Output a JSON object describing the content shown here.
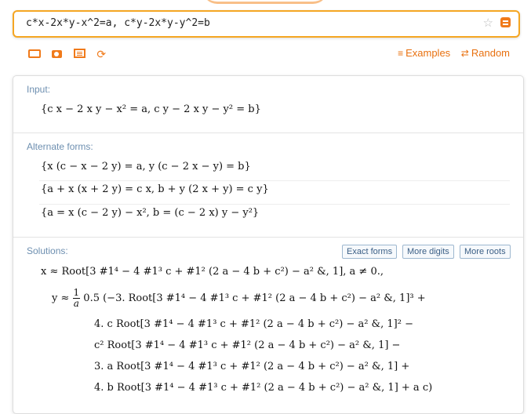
{
  "query": {
    "value": "c*x-2x*y-x^2=a, c*y-2x*y-y^2=b"
  },
  "toolbar": {
    "examples_label": "Examples",
    "random_label": "Random"
  },
  "input_pod": {
    "title": "Input:",
    "line": "{c x − 2 x y − x² = a, c y − 2 x y − y² = b}"
  },
  "alternate_pod": {
    "title": "Alternate forms:",
    "forms": [
      "{x (c − x − 2 y) = a, y (c − 2 x − y) = b}",
      "{a + x (x + 2 y) = c x, b + y (2 x + y) = c y}",
      "{a = x (c − 2 y) − x², b = (c − 2 x) y − y²}"
    ]
  },
  "solutions_pod": {
    "title": "Solutions:",
    "buttons": [
      "Exact forms",
      "More digits",
      "More roots"
    ],
    "x_line": "x ≈ Root[3 #1⁴ − 4 #1³ c + #1² (2 a − 4 b + c²) − a² &, 1],   a ≠ 0.,",
    "y_lead": "y ≈",
    "frac_num": "1",
    "frac_den": "a",
    "y_line1": "0.5 (−3. Root[3 #1⁴ − 4 #1³ c + #1² (2 a − 4 b + c²) − a² &, 1]³ +",
    "y_line2": "4. c Root[3 #1⁴ − 4 #1³ c + #1² (2 a − 4 b + c²) − a² &, 1]² −",
    "y_line3": "c² Root[3 #1⁴ − 4 #1³ c + #1² (2 a − 4 b + c²) − a² &, 1] −",
    "y_line4": "3. a Root[3 #1⁴ − 4 #1³ c + #1² (2 a − 4 b + c²) − a² &, 1] +",
    "y_line5": "4. b Root[3 #1⁴ − 4 #1³ c + #1² (2 a − 4 b + c²) − a² &, 1] + a c)"
  },
  "colors": {
    "accent": "#f07a1a",
    "query_border": "#f5a623",
    "pod_title": "#6d8fb0",
    "button_border": "#9db7cf"
  },
  "icons": [
    "keyboard-icon",
    "camera-icon",
    "document-icon",
    "share-icon",
    "star-icon",
    "go-icon"
  ]
}
